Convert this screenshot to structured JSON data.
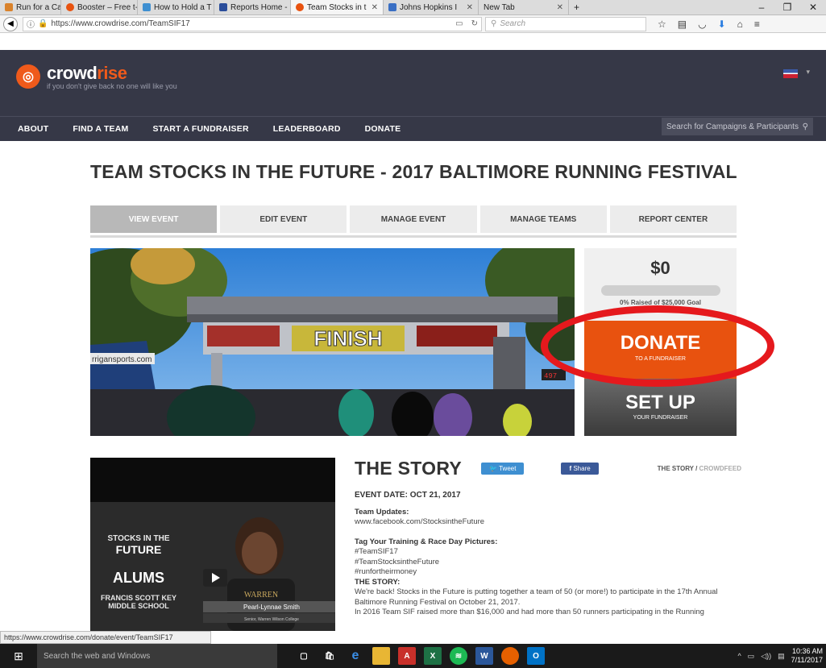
{
  "browser": {
    "tabs": [
      {
        "label": "Run for a Cause -",
        "color": "#d9822b"
      },
      {
        "label": "Booster – Free t-",
        "color": "#e8520f"
      },
      {
        "label": "How to Hold a T",
        "color": "#3e8fd1"
      },
      {
        "label": "Reports Home -",
        "color": "#2a4d9b"
      },
      {
        "label": "Team Stocks in t",
        "color": "#e8520f"
      },
      {
        "label": "Johns Hopkins I",
        "color": "#3a6fc4"
      },
      {
        "label": "New Tab",
        "color": ""
      }
    ],
    "new_tab_symbol": "+",
    "url": "https://www.crowdrise.com/TeamSIF17",
    "search_placeholder": "Search",
    "status_url": "https://www.crowdrise.com/donate/event/TeamSIF17"
  },
  "site": {
    "logo_crowd": "crowd",
    "logo_rise": "rise",
    "tagline": "if you don't give back no one will like you",
    "nav": [
      "ABOUT",
      "FIND A TEAM",
      "START A FUNDRAISER",
      "LEADERBOARD",
      "DONATE"
    ],
    "search_placeholder": "Search for Campaigns & Participants"
  },
  "page": {
    "title": "TEAM STOCKS IN THE FUTURE - 2017 BALTIMORE RUNNING FESTIVAL",
    "tabs": [
      "VIEW EVENT",
      "EDIT EVENT",
      "MANAGE EVENT",
      "MANAGE TEAMS",
      "REPORT CENTER"
    ],
    "hero_sign": "FINISH",
    "amount": "$0",
    "progress_fraction": 0,
    "goal_text": "0% Raised of $25,000 Goal",
    "donate": {
      "big": "DONATE",
      "small": "TO A FUNDRAISER"
    },
    "setup": {
      "big": "SET UP",
      "small": "YOUR FUNDRAISER"
    }
  },
  "video": {
    "line1": "STOCKS IN THE",
    "line2": "FUTURE",
    "line3": "ALUMS",
    "line4": "FRANCIS SCOTT KEY",
    "line5": "MIDDLE SCHOOL",
    "name": "Pearl-Lynnae Smith",
    "role": "Senior, Warren Wilson College",
    "shirt": "WARREN"
  },
  "story": {
    "title": "THE STORY",
    "tweet": "Tweet",
    "share": "Share",
    "nav_active": "THE STORY",
    "nav_sep": " / ",
    "nav_other": "CROWDFEED",
    "event_date": "EVENT DATE: OCT 21, 2017",
    "team_updates_label": "Team Updates:",
    "team_updates_url": "www.facebook.com/StocksintheFuture",
    "tag_label": "Tag Your Training & Race Day Pictures:",
    "tags": [
      "#TeamSIF17",
      "#TeamStocksintheFuture",
      "#runfortheirmoney"
    ],
    "story_label": "THE STORY:",
    "p1": "We're back! Stocks in the Future is putting together a team of 50 (or more!) to participate in the 17th Annual Baltimore Running Festival on October 21, 2017.",
    "p2": "In 2016 Team SIF raised more than $16,000 and had more than 50 runners participating in the Running"
  },
  "taskbar": {
    "search": "Search the web and Windows",
    "time": "10:36 AM",
    "date": "7/11/2017"
  }
}
